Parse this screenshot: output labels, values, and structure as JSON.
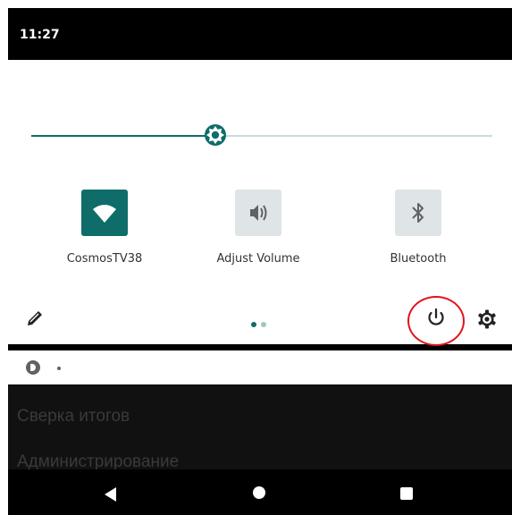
{
  "status_bar": {
    "time": "11:27"
  },
  "brightness": {
    "level": 0.4
  },
  "tiles": [
    {
      "label": "CosmosTV38",
      "icon": "wifi-icon",
      "state": "on"
    },
    {
      "label": "Adjust Volume",
      "icon": "volume-icon",
      "state": "off"
    },
    {
      "label": "Bluetooth",
      "icon": "bluetooth-icon",
      "state": "off"
    }
  ],
  "footer": {
    "edit_icon": "pencil-icon",
    "page_count": 2,
    "active_page": 1,
    "power_icon": "power-icon",
    "settings_icon": "gear-icon"
  },
  "background_app": {
    "items": [
      "Сверка итогов",
      "Администрирование"
    ]
  },
  "nav": {
    "back_icon": "back-icon",
    "home_icon": "home-icon",
    "recents_icon": "recents-icon"
  },
  "colors": {
    "accent": "#0f6d69",
    "tile_off": "#dfe4e6",
    "highlight_ring": "#e0141a"
  }
}
